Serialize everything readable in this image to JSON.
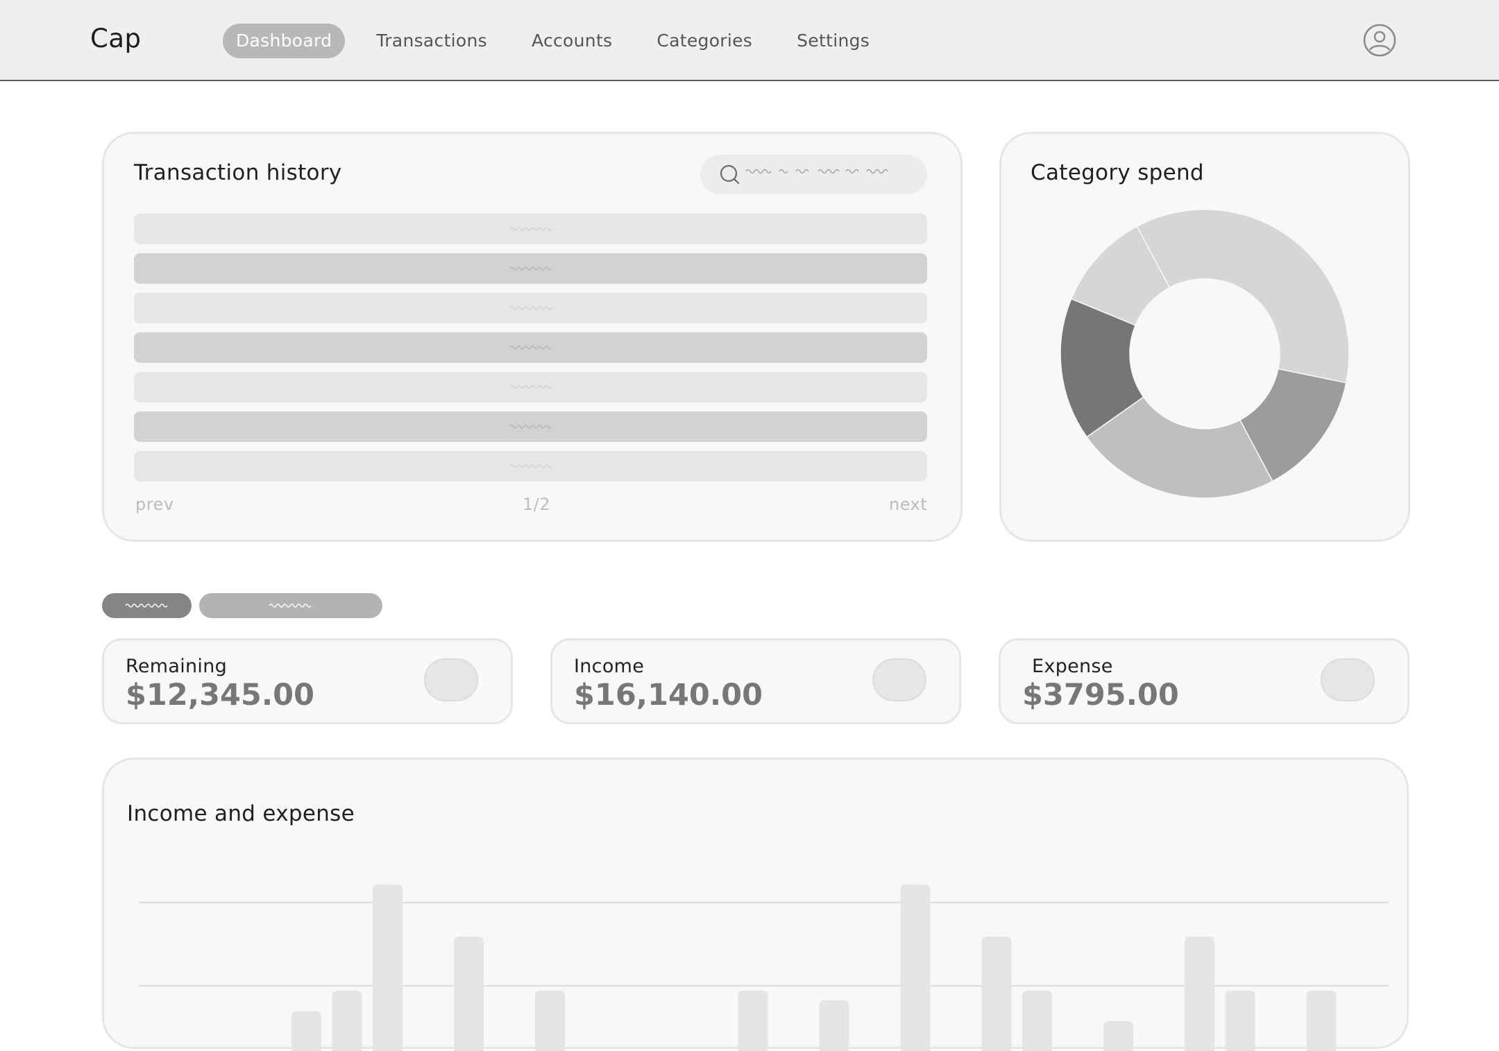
{
  "brand": "Cap",
  "nav": {
    "items": [
      {
        "label": "Dashboard",
        "active": true
      },
      {
        "label": "Transactions",
        "active": false
      },
      {
        "label": "Accounts",
        "active": false
      },
      {
        "label": "Categories",
        "active": false
      },
      {
        "label": "Settings",
        "active": false
      }
    ],
    "avatar_icon": "user-circle-icon"
  },
  "transaction_history": {
    "title": "Transaction history",
    "search_icon": "search-icon",
    "row_count": 7,
    "pager": {
      "prev": "prev",
      "page": "1/2",
      "next": "next"
    }
  },
  "category_spend": {
    "title": "Category spend",
    "chart_data": {
      "type": "pie",
      "style": "donut",
      "slices": [
        {
          "value": 36,
          "color": "#d6d6d6"
        },
        {
          "value": 14,
          "color": "#9c9c9c"
        },
        {
          "value": 23,
          "color": "#bfbfbf"
        },
        {
          "value": 16,
          "color": "#767676"
        },
        {
          "value": 11,
          "color": "#d6d6d6"
        }
      ]
    }
  },
  "chips": [
    {
      "color": "#858585"
    },
    {
      "color": "#b3b3b3"
    }
  ],
  "stats": {
    "remaining": {
      "label": "Remaining",
      "value": "$12,345.00"
    },
    "income": {
      "label": "Income",
      "value": "$16,140.00"
    },
    "expense": {
      "label": "Expense",
      "value": "$3795.00"
    }
  },
  "income_expense": {
    "title": "Income and expense",
    "chart_data": {
      "type": "bar",
      "grid": true,
      "legend": "none",
      "bar_color": "#e5e5e5",
      "gridline_color": "#dddddd",
      "values": [
        0,
        0,
        0,
        0,
        22,
        52,
        205,
        0,
        130,
        0,
        52,
        0,
        0,
        0,
        0,
        52,
        0,
        38,
        0,
        205,
        0,
        130,
        52,
        0,
        8,
        0,
        130,
        52,
        0,
        52,
        0,
        0
      ]
    }
  }
}
